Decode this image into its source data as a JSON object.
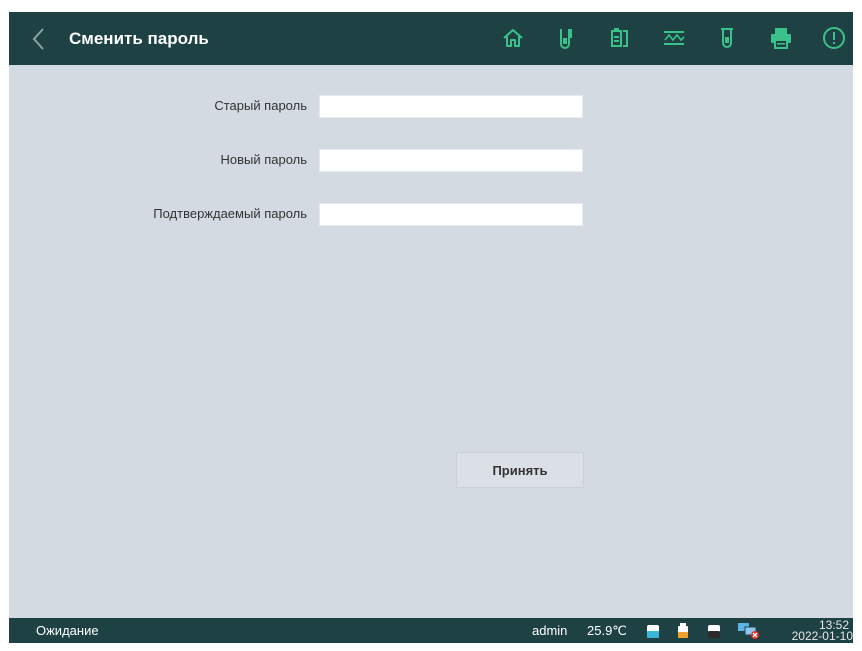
{
  "header": {
    "title": "Сменить пароль",
    "icons": [
      "back-icon",
      "home-icon",
      "sample-tube-icon",
      "reagent-icon",
      "calibration-curve-icon",
      "test-tube-icon",
      "printer-icon",
      "alert-icon"
    ],
    "background": "#1e4244",
    "accent": "#3bc28a"
  },
  "form": {
    "old_password_label": "Старый пароль",
    "old_password_value": "",
    "new_password_label": "Новый пароль",
    "new_password_value": "",
    "confirm_password_label": "Подтверждаемый пароль",
    "confirm_password_value": "",
    "accept_label": "Принять"
  },
  "footer": {
    "status": "Ожидание",
    "user": "admin",
    "temperature": "25.9℃",
    "time": "13:52",
    "date": "2022-01-10",
    "icons": [
      "reagent-bottle-cyan-icon",
      "reagent-bottle-orange-icon",
      "waste-bottle-icon",
      "network-disconnected-icon"
    ]
  }
}
